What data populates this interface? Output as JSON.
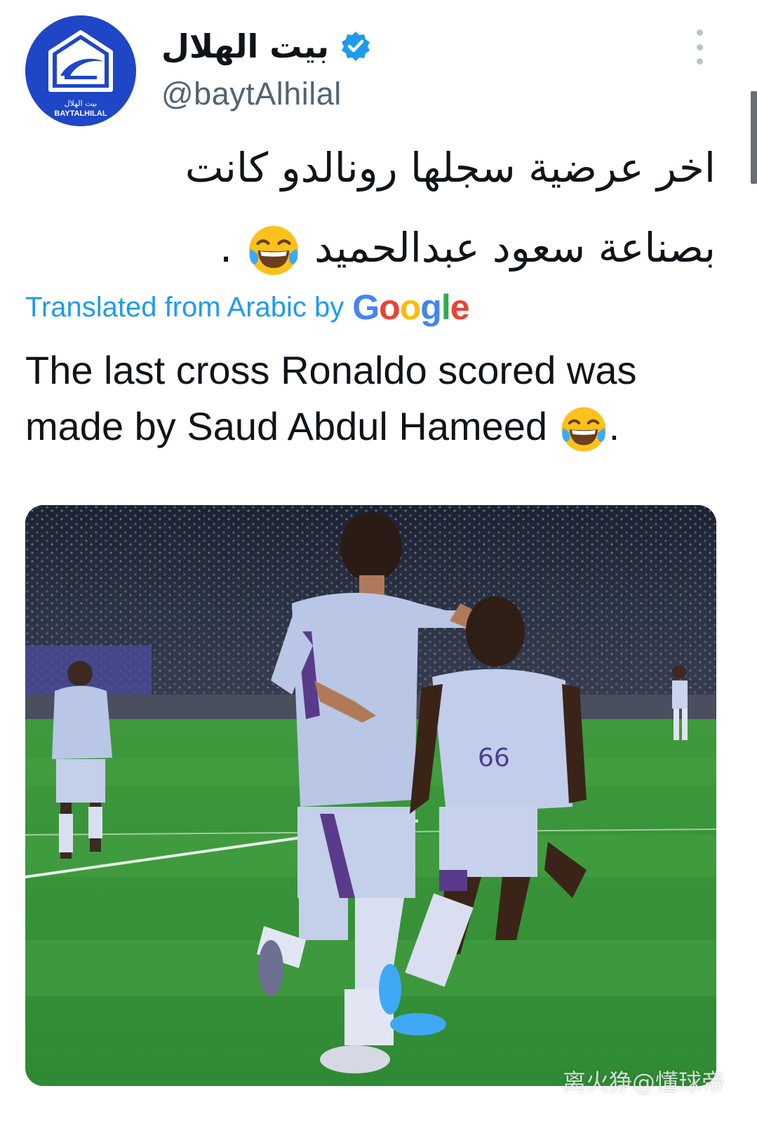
{
  "account": {
    "display_name": "بيت الهلال",
    "handle": "@baytAlhilal",
    "avatar_arabic": "بيت الهلال",
    "avatar_text": "BAYTALHILAL",
    "verified": true
  },
  "tweet": {
    "arabic_lines": [
      "اخر عرضية سجلها رونالدو كانت",
      "بصناعة سعود عبدالحميد"
    ],
    "arabic_line2_end": ".",
    "translated_label": "Translated from Arabic by",
    "translator_logo": "Google",
    "english_lines": [
      "The last cross Ronaldo scored was",
      "made by Saud Abdul Hameed"
    ],
    "english_line2_end": "."
  },
  "emoji": "face-with-tears-of-joy",
  "photo": {
    "jersey_number": "66"
  },
  "watermark": "离火狰@懂球帝",
  "colors": {
    "link_blue": "#1d9bf0",
    "avatar_blue": "#1e46c6",
    "handle_gray": "#536471",
    "text": "#0f1419"
  }
}
